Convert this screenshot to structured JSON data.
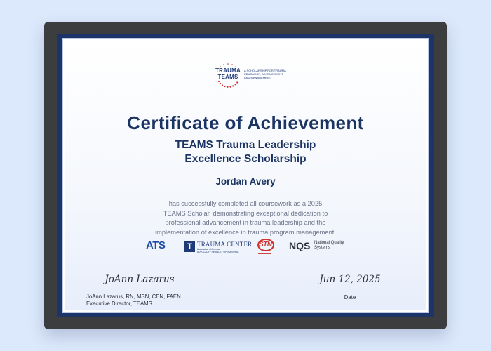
{
  "logo": {
    "name_line1": "TRAUMA",
    "name_line2": "TEAMS",
    "tagline": "A scholarship for trauma education, advancement, and management"
  },
  "certificate": {
    "title": "Certificate of Achievement",
    "subtitle_line1": "TEAMS Trauma Leadership",
    "subtitle_line2": "Excellence Scholarship",
    "recipient": "Jordan Avery",
    "body_line1": "has successfully completed all coursework as a 2025",
    "body_line2": "TEAMS Scholar, demonstrating exceptional dedication to",
    "body_line3": "professional advancement in trauma leadership and the",
    "body_line4": "implementation of excellence in trauma program management."
  },
  "partners": {
    "ats": {
      "mark": "ATS"
    },
    "tca": {
      "box": "T",
      "name": "TRAUMA CENTER",
      "sub": "Association of America",
      "tag": "ADVOCACY · FINANCE · OPERATIONAL"
    },
    "stn": {
      "mark": "STN"
    },
    "nqs": {
      "mark": "NQS",
      "name_line1": "National Quality",
      "name_line2": "Systems"
    }
  },
  "signature": {
    "script": "JoAnn Lazarus",
    "name_line1": "JoAnn Lazarus, RN, MSN, CEN, FAEN",
    "name_line2": "Executive Director, TEAMS"
  },
  "date": {
    "script": "Jun 12, 2025",
    "label": "Date"
  },
  "colors": {
    "navy": "#1b3463",
    "frame": "#3c3d3f",
    "mat": "#1c3468",
    "accent_red": "#d0332e",
    "background": "#dce8fb"
  }
}
